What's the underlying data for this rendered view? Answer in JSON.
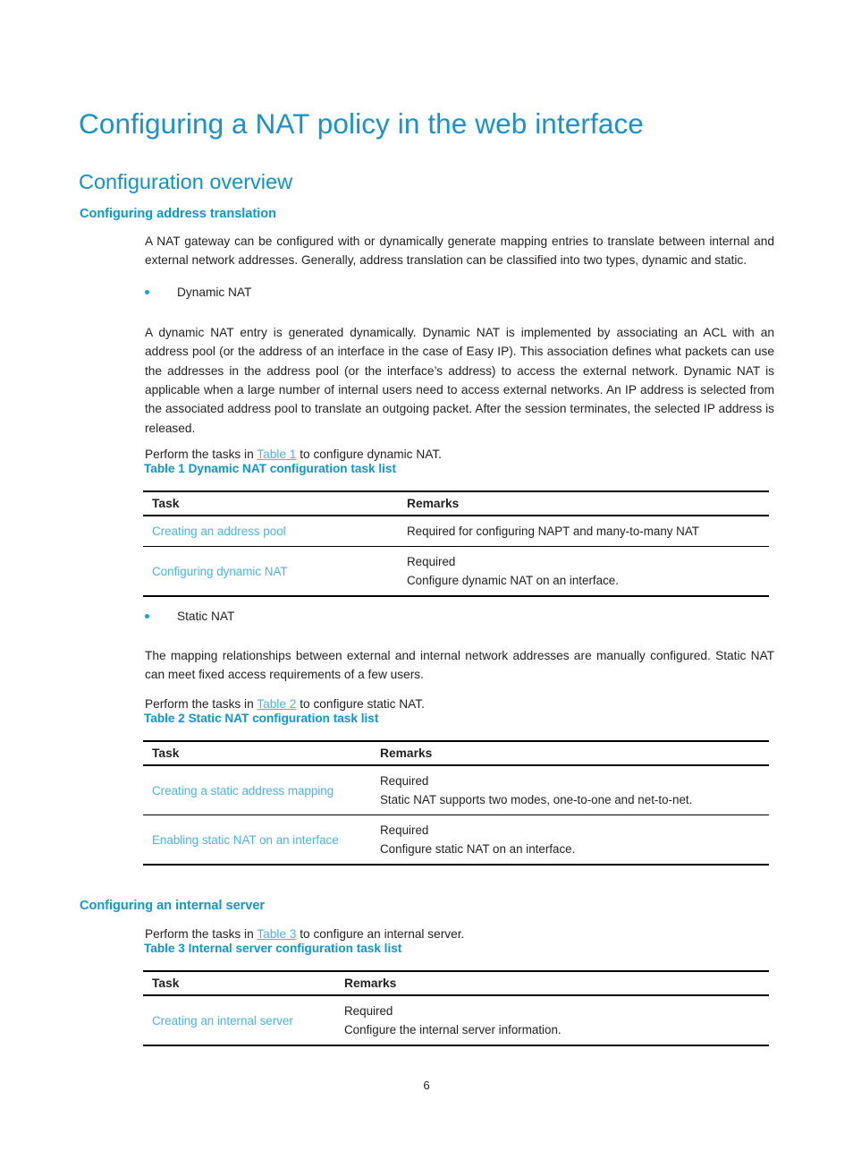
{
  "document": {
    "title": "Configuring a NAT policy in the web interface",
    "page_number": "6"
  },
  "sections": {
    "configuration_overview": {
      "heading": "Configuration overview",
      "address_translation": {
        "heading": "Configuring address translation",
        "intro_paragraph": "A NAT gateway can be configured with or dynamically generate mapping entries to translate between internal and external network addresses. Generally, address translation can be classified into two types, dynamic and static.",
        "bullet_dynamic": "Dynamic NAT",
        "dynamic_paragraph": "A dynamic NAT entry is generated dynamically. Dynamic NAT is implemented by associating an ACL with an address pool (or the address of an interface in the case of Easy IP). This association defines what packets can use the addresses in the address pool (or the interface’s address) to access the external network. Dynamic NAT is applicable when a large number of internal users need to access external networks. An IP address is selected from the associated address pool to translate an outgoing packet. After the session terminates, the selected IP address is released.",
        "perform_dynamic_prefix": "Perform the tasks in ",
        "perform_dynamic_link": "Table 1",
        "perform_dynamic_suffix": " to configure dynamic NAT.",
        "bullet_static": "Static NAT",
        "static_paragraph": "The mapping relationships between external and internal network addresses are manually configured. Static NAT can meet fixed access requirements of a few users.",
        "perform_static_prefix": "Perform the tasks in ",
        "perform_static_link": "Table 2",
        "perform_static_suffix": " to configure static NAT."
      },
      "internal_server": {
        "heading": "Configuring an internal server",
        "perform_prefix": "Perform the tasks in ",
        "perform_link": "Table 3",
        "perform_suffix": " to configure an internal server."
      }
    }
  },
  "tables": {
    "table1": {
      "caption": "Table 1 Dynamic NAT configuration task list",
      "headers": {
        "task": "Task",
        "remarks": "Remarks"
      },
      "rows": [
        {
          "task": "Creating an address pool",
          "remark_line1": "Required for configuring NAPT and many-to-many NAT",
          "remark_line2": ""
        },
        {
          "task": "Configuring dynamic NAT",
          "remark_line1": "Required",
          "remark_line2": "Configure dynamic NAT on an interface."
        }
      ]
    },
    "table2": {
      "caption": "Table 2 Static NAT configuration task list",
      "headers": {
        "task": "Task",
        "remarks": "Remarks"
      },
      "rows": [
        {
          "task": "Creating a static address mapping",
          "remark_line1": "Required",
          "remark_line2": "Static NAT supports two modes, one-to-one and net-to-net."
        },
        {
          "task": "Enabling static NAT on an interface",
          "remark_line1": "Required",
          "remark_line2": "Configure static NAT on an interface."
        }
      ]
    },
    "table3": {
      "caption": "Table 3 Internal server configuration task list",
      "headers": {
        "task": "Task",
        "remarks": "Remarks"
      },
      "rows": [
        {
          "task": "Creating an internal server",
          "remark_line1": "Required",
          "remark_line2": "Configure the internal server information."
        }
      ]
    }
  },
  "colors": {
    "title_blue": "#1893cf",
    "heading_blue": "#0d97d6",
    "link_blue": "#4bb4e2",
    "bullet_blue": "#1b9dd9",
    "body_text": "#231f20",
    "rule_black": "#000000"
  }
}
